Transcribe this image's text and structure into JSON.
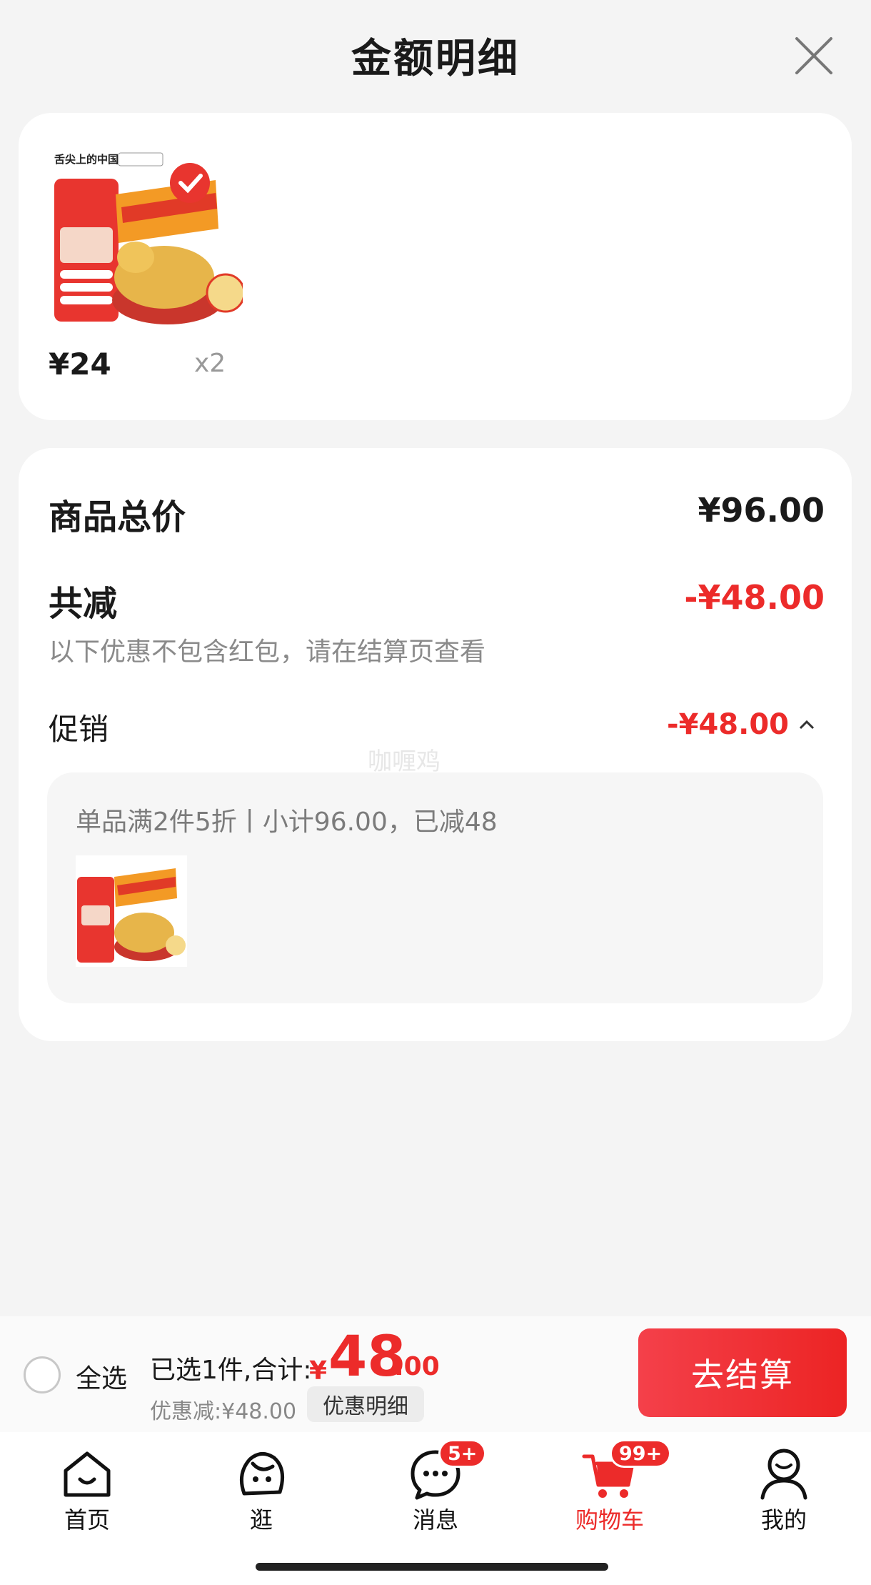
{
  "header": {
    "title": "金额明细",
    "close_icon": "close-icon"
  },
  "product": {
    "price": "¥24",
    "quantity": "x2"
  },
  "summary": {
    "total_label": "商品总价",
    "total_value": "¥96.00",
    "reduced_label": "共减",
    "reduced_value": "-¥48.00",
    "note": "以下优惠不包含红包，请在结算页查看",
    "promo_label": "促销",
    "promo_value": "-¥48.00",
    "promo_detail": "单品满2件5折丨小计96.00，已减48",
    "watermark": "咖喱鸡"
  },
  "bottom_bar": {
    "select_all": "全选",
    "selected_info": "已选1件,合计:",
    "total_symbol": "¥",
    "total_integer": "48",
    "total_decimal": ".00",
    "discount_info": "优惠减:¥48.00",
    "detail_button": "优惠明细",
    "checkout_button": "去结算"
  },
  "tabbar": {
    "items": [
      {
        "label": "首页",
        "icon": "home-icon"
      },
      {
        "label": "逛",
        "icon": "browse-icon"
      },
      {
        "label": "消息",
        "icon": "message-icon",
        "badge": "5+"
      },
      {
        "label": "购物车",
        "icon": "cart-icon",
        "badge": "99+",
        "active": true
      },
      {
        "label": "我的",
        "icon": "profile-icon"
      }
    ]
  },
  "colors": {
    "accent": "#ec2b2a",
    "background": "#f4f4f4"
  }
}
